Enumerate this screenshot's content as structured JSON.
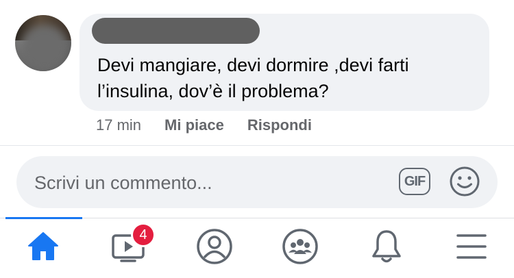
{
  "comment": {
    "text": "Devi mangiare, devi dormire ,devi farti l’insulina, dov’è il problema?",
    "time": "17 min",
    "like_label": "Mi piace",
    "reply_label": "Rispondi"
  },
  "composer": {
    "placeholder": "Scrivi un commento...",
    "gif_label": "GIF"
  },
  "tabbar": {
    "active_color": "#1877f2",
    "icon_color": "#606770",
    "badge_color": "#e41e3f",
    "items": [
      {
        "icon": "home-icon",
        "active": true
      },
      {
        "icon": "watch-video-icon",
        "badge": "4"
      },
      {
        "icon": "profile-icon"
      },
      {
        "icon": "groups-icon"
      },
      {
        "icon": "notifications-bell-icon"
      },
      {
        "icon": "menu-icon"
      }
    ]
  }
}
